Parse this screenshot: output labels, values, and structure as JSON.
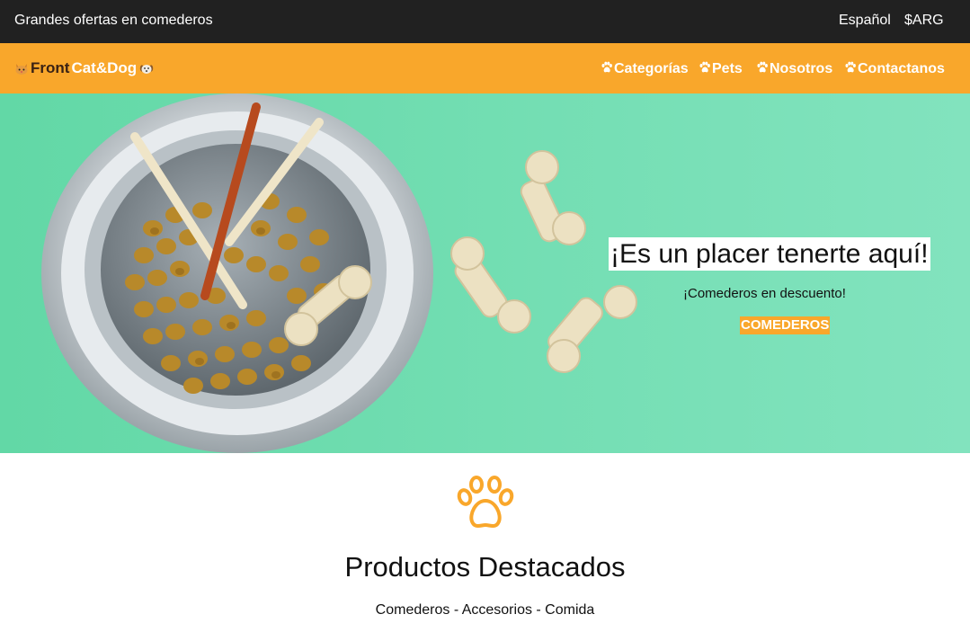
{
  "topbar": {
    "promo": "Grandes ofertas en comederos",
    "language": "Español",
    "currency": "$ARG"
  },
  "brand": {
    "word1": "Front",
    "word2": "Cat&Dog",
    "icon_left": "cat-face-icon",
    "icon_right": "dog-face-icon"
  },
  "nav": {
    "items": [
      {
        "label": "Categorías",
        "icon": "paw-icon"
      },
      {
        "label": "Pets",
        "icon": "paw-icon"
      },
      {
        "label": "Nosotros",
        "icon": "paw-icon"
      },
      {
        "label": "Contactanos",
        "icon": "paw-icon"
      }
    ]
  },
  "hero": {
    "title": "¡Es un placer tenerte aquí!",
    "subtitle": "¡Comederos en descuento!",
    "cta": "COMEDEROS"
  },
  "featured": {
    "icon": "paw-outline-icon",
    "title": "Productos Destacados",
    "subtitle": "Comederos - Accesorios - Comida"
  },
  "colors": {
    "topbar": "#212121",
    "accent": "#f9a72b",
    "hero_background": "#6fdcb0",
    "brand_dark": "#3a2214"
  }
}
